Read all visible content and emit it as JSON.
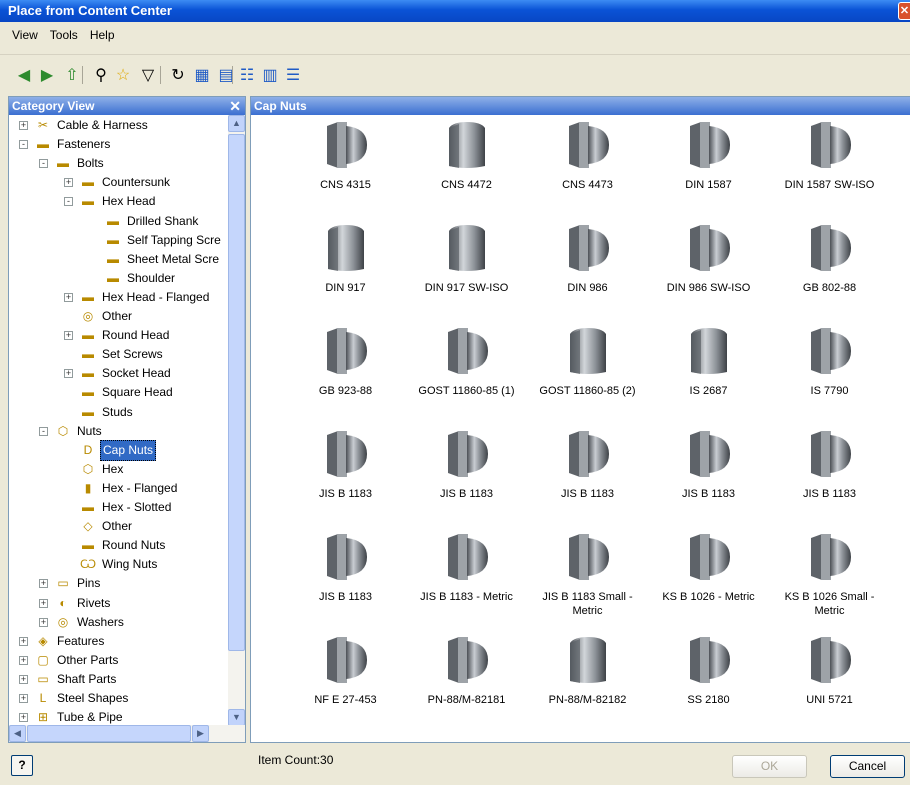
{
  "window": {
    "title": "Place from Content Center"
  },
  "menu": [
    "View",
    "Tools",
    "Help"
  ],
  "toolbar": {
    "buttons": [
      {
        "name": "back-icon",
        "glyph": "◀"
      },
      {
        "name": "forward-icon",
        "glyph": "▶"
      },
      {
        "name": "up-folder-icon",
        "glyph": "⇧"
      },
      {
        "name": "search-icon",
        "glyph": "⚲"
      },
      {
        "name": "favorites-icon",
        "glyph": "☆"
      },
      {
        "name": "filter-icon",
        "glyph": "▽"
      },
      {
        "name": "refresh-icon",
        "glyph": "↻"
      },
      {
        "name": "tree-view-icon",
        "glyph": "▦"
      },
      {
        "name": "table-view-icon",
        "glyph": "▤"
      },
      {
        "name": "view-options-icon",
        "glyph": "☷"
      },
      {
        "name": "thumbnail-view-icon",
        "glyph": "▥"
      },
      {
        "name": "details-view-icon",
        "glyph": "☰"
      }
    ]
  },
  "left_panel": {
    "title": "Category View",
    "close_glyph": "✕",
    "tree": [
      {
        "label": "Cable & Harness",
        "level": 0,
        "expander": "+",
        "icon": "✂"
      },
      {
        "label": "Fasteners",
        "level": 0,
        "expander": "-",
        "icon": "▬"
      },
      {
        "label": "Bolts",
        "level": 1,
        "expander": "-",
        "icon": "▬"
      },
      {
        "label": "Countersunk",
        "level": 2,
        "expander": "+",
        "icon": "▬"
      },
      {
        "label": "Hex Head",
        "level": 2,
        "expander": "-",
        "icon": "▬"
      },
      {
        "label": "Drilled Shank",
        "level": 3,
        "expander": "",
        "icon": "▬"
      },
      {
        "label": "Self Tapping Scre",
        "level": 3,
        "expander": "",
        "icon": "▬"
      },
      {
        "label": "Sheet Metal Scre",
        "level": 3,
        "expander": "",
        "icon": "▬"
      },
      {
        "label": "Shoulder",
        "level": 3,
        "expander": "",
        "icon": "▬"
      },
      {
        "label": "Hex Head - Flanged",
        "level": 2,
        "expander": "+",
        "icon": "▬"
      },
      {
        "label": "Other",
        "level": 2,
        "expander": "",
        "icon": "◎"
      },
      {
        "label": "Round Head",
        "level": 2,
        "expander": "+",
        "icon": "▬"
      },
      {
        "label": "Set Screws",
        "level": 2,
        "expander": "",
        "icon": "▬"
      },
      {
        "label": "Socket Head",
        "level": 2,
        "expander": "+",
        "icon": "▬"
      },
      {
        "label": "Square Head",
        "level": 2,
        "expander": "",
        "icon": "▬"
      },
      {
        "label": "Studs",
        "level": 2,
        "expander": "",
        "icon": "▬"
      },
      {
        "label": "Nuts",
        "level": 1,
        "expander": "-",
        "icon": "⬡"
      },
      {
        "label": "Cap Nuts",
        "level": 2,
        "expander": "",
        "icon": "D",
        "selected": true
      },
      {
        "label": "Hex",
        "level": 2,
        "expander": "",
        "icon": "⬡"
      },
      {
        "label": "Hex - Flanged",
        "level": 2,
        "expander": "",
        "icon": "▮"
      },
      {
        "label": "Hex - Slotted",
        "level": 2,
        "expander": "",
        "icon": "▬"
      },
      {
        "label": "Other",
        "level": 2,
        "expander": "",
        "icon": "◇"
      },
      {
        "label": "Round Nuts",
        "level": 2,
        "expander": "",
        "icon": "▬"
      },
      {
        "label": "Wing Nuts",
        "level": 2,
        "expander": "",
        "icon": "Ѡ"
      },
      {
        "label": "Pins",
        "level": 1,
        "expander": "+",
        "icon": "▭"
      },
      {
        "label": "Rivets",
        "level": 1,
        "expander": "+",
        "icon": "◐"
      },
      {
        "label": "Washers",
        "level": 1,
        "expander": "+",
        "icon": "◎"
      },
      {
        "label": "Features",
        "level": 0,
        "expander": "+",
        "icon": "◈"
      },
      {
        "label": "Other Parts",
        "level": 0,
        "expander": "+",
        "icon": "▢"
      },
      {
        "label": "Shaft Parts",
        "level": 0,
        "expander": "+",
        "icon": "▭"
      },
      {
        "label": "Steel Shapes",
        "level": 0,
        "expander": "+",
        "icon": "L"
      },
      {
        "label": "Tube & Pipe",
        "level": 0,
        "expander": "+",
        "icon": "⊞"
      }
    ]
  },
  "right_panel": {
    "title": "Cap Nuts",
    "items": [
      {
        "label": "CNS 4315",
        "shape": "acorn"
      },
      {
        "label": "CNS 4472",
        "shape": "hex"
      },
      {
        "label": "CNS 4473",
        "shape": "acorn"
      },
      {
        "label": "DIN 1587",
        "shape": "acorn"
      },
      {
        "label": "DIN 1587 SW-ISO",
        "shape": "acorn"
      },
      {
        "label": "DIN 917",
        "shape": "hex"
      },
      {
        "label": "DIN 917 SW-ISO",
        "shape": "hex"
      },
      {
        "label": "DIN 986",
        "shape": "acorn"
      },
      {
        "label": "DIN 986 SW-ISO",
        "shape": "acorn"
      },
      {
        "label": "GB 802-88",
        "shape": "acorn"
      },
      {
        "label": "GB 923-88",
        "shape": "acorn"
      },
      {
        "label": "GOST 11860-85 (1)",
        "shape": "acorn"
      },
      {
        "label": "GOST 11860-85 (2)",
        "shape": "hex"
      },
      {
        "label": "IS 2687",
        "shape": "hex"
      },
      {
        "label": "IS 7790",
        "shape": "acorn"
      },
      {
        "label": "JIS B 1183",
        "shape": "acorn"
      },
      {
        "label": "JIS B 1183",
        "shape": "acorn"
      },
      {
        "label": "JIS B 1183",
        "shape": "acorn"
      },
      {
        "label": "JIS B 1183",
        "shape": "acorn"
      },
      {
        "label": "JIS B 1183",
        "shape": "acorn"
      },
      {
        "label": "JIS B 1183",
        "shape": "acorn"
      },
      {
        "label": "JIS B 1183 - Metric",
        "shape": "acorn"
      },
      {
        "label": "JIS B 1183 Small - Metric",
        "shape": "acorn"
      },
      {
        "label": "KS B 1026 - Metric",
        "shape": "acorn"
      },
      {
        "label": "KS B 1026 Small - Metric",
        "shape": "acorn"
      },
      {
        "label": "NF E 27-453",
        "shape": "acorn"
      },
      {
        "label": "PN-88/M-82181",
        "shape": "acorn"
      },
      {
        "label": "PN-88/M-82182",
        "shape": "hex"
      },
      {
        "label": "SS 2180",
        "shape": "acorn"
      },
      {
        "label": "UNI 5721",
        "shape": "acorn"
      }
    ]
  },
  "status": {
    "item_count": "Item Count:30",
    "help_glyph": "?"
  },
  "buttons": {
    "ok": "OK",
    "cancel": "Cancel"
  },
  "colors": {
    "title_bar": "#0a53d6",
    "selection": "#316ac5",
    "pane_header": "#3b6fd1"
  }
}
